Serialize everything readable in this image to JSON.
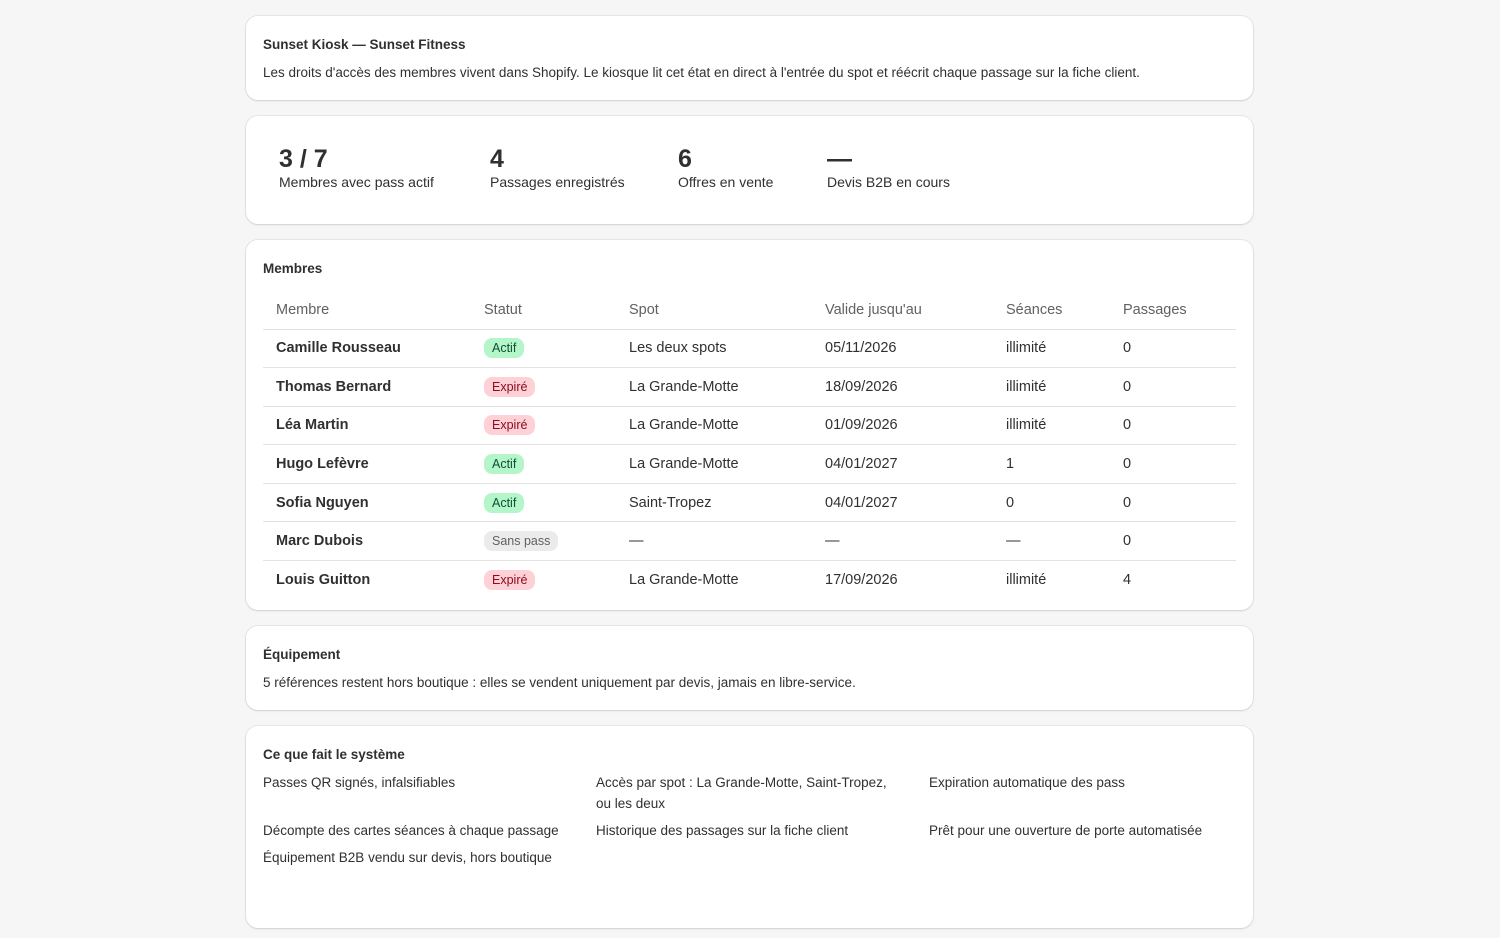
{
  "intro": {
    "title": "Sunset Kiosk — Sunset Fitness",
    "text": "Les droits d'accès des membres vivent dans Shopify. Le kiosque lit cet état en direct à l'entrée du spot et réécrit chaque passage sur la fiche client."
  },
  "stats": [
    {
      "value": "3 / 7",
      "label": "Membres avec pass actif"
    },
    {
      "value": "4",
      "label": "Passages enregistrés"
    },
    {
      "value": "6",
      "label": "Offres en vente"
    },
    {
      "value": "—",
      "label": "Devis B2B en cours"
    }
  ],
  "members": {
    "title": "Membres",
    "columns": [
      "Membre",
      "Statut",
      "Spot",
      "Valide jusqu'au",
      "Séances",
      "Passages"
    ],
    "rows": [
      {
        "name": "Camille Rousseau",
        "status": "Actif",
        "status_kind": "actif",
        "spot": "Les deux spots",
        "valid_until": "05/11/2026",
        "sessions": "illimité",
        "passages": "0"
      },
      {
        "name": "Thomas Bernard",
        "status": "Expiré",
        "status_kind": "expire",
        "spot": "La Grande-Motte",
        "valid_until": "18/09/2026",
        "sessions": "illimité",
        "passages": "0"
      },
      {
        "name": "Léa Martin",
        "status": "Expiré",
        "status_kind": "expire",
        "spot": "La Grande-Motte",
        "valid_until": "01/09/2026",
        "sessions": "illimité",
        "passages": "0"
      },
      {
        "name": "Hugo Lefèvre",
        "status": "Actif",
        "status_kind": "actif",
        "spot": "La Grande-Motte",
        "valid_until": "04/01/2027",
        "sessions": "1",
        "passages": "0"
      },
      {
        "name": "Sofia Nguyen",
        "status": "Actif",
        "status_kind": "actif",
        "spot": "Saint-Tropez",
        "valid_until": "04/01/2027",
        "sessions": "0",
        "passages": "0"
      },
      {
        "name": "Marc Dubois",
        "status": "Sans pass",
        "status_kind": "sans",
        "spot": "—",
        "valid_until": "—",
        "sessions": "—",
        "passages": "0"
      },
      {
        "name": "Louis Guitton",
        "status": "Expiré",
        "status_kind": "expire",
        "spot": "La Grande-Motte",
        "valid_until": "17/09/2026",
        "sessions": "illimité",
        "passages": "4"
      }
    ]
  },
  "equipment": {
    "title": "Équipement",
    "text": "5 références restent hors boutique : elles se vendent uniquement par devis, jamais en libre-service."
  },
  "system": {
    "title": "Ce que fait le système",
    "features": [
      "Passes QR signés, infalsifiables",
      "Accès par spot : La Grande-Motte, Saint-Tropez, ou les deux",
      "Expiration automatique des pass",
      "Décompte des cartes séances à chaque passage",
      "Historique des passages sur la fiche client",
      "Prêt pour une ouverture de porte automatisée",
      "Équipement B2B vendu sur devis, hors boutique"
    ]
  },
  "colors": {
    "badge_actif_bg": "#b4f5c9",
    "badge_expire_bg": "#fed1d7",
    "badge_sans_bg": "#ebebeb"
  }
}
